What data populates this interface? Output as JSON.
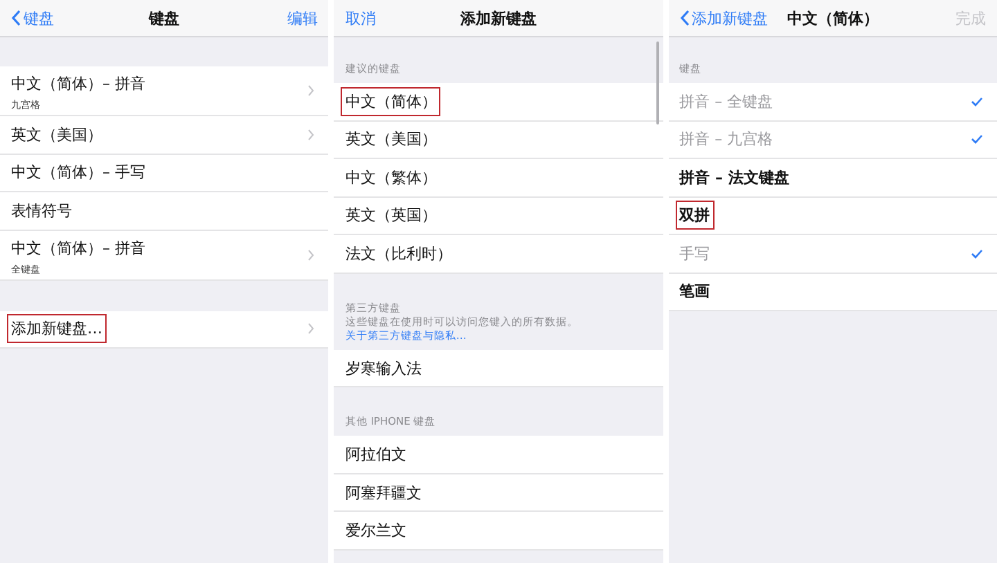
{
  "panels": [
    {
      "nav": {
        "left": {
          "label": "键盘",
          "arrow": true
        },
        "title": "键盘",
        "right": {
          "label": "编辑",
          "disabled": false
        }
      },
      "sections": [
        {
          "rows": [
            {
              "label": "中文（简体）– 拼音",
              "sublabel": "九宫格",
              "chevron": true,
              "highlighted": false
            },
            {
              "label": "英文（美国）",
              "chevron": true,
              "highlighted": false
            },
            {
              "label": "中文（简体）– 手写",
              "chevron": false,
              "highlighted": false
            },
            {
              "label": "表情符号",
              "chevron": false,
              "highlighted": false
            },
            {
              "label": "中文（简体）– 拼音",
              "sublabel": "全键盘",
              "chevron": true,
              "highlighted": false
            }
          ]
        },
        {
          "rows": [
            {
              "label": "添加新键盘…",
              "chevron": true,
              "highlighted": true
            }
          ]
        }
      ]
    },
    {
      "nav": {
        "left": {
          "label": "取消"
        },
        "title": "添加新键盘"
      },
      "scroll_indicator": true,
      "sections": [
        {
          "header": "建议的键盘",
          "rows": [
            {
              "label": "中文（简体）",
              "highlighted": true
            },
            {
              "label": "英文（美国）",
              "highlighted": false
            },
            {
              "label": "中文（繁体）",
              "highlighted": false
            },
            {
              "label": "英文（英国）",
              "highlighted": false
            },
            {
              "label": "法文（比利时）",
              "highlighted": false
            }
          ]
        },
        {
          "header": "第三方键盘",
          "note": "这些键盘在使用时可以访问您键入的所有数据。",
          "link": "关于第三方键盘与隐私…",
          "rows": [
            {
              "label": "岁寒输入法",
              "highlighted": false
            }
          ]
        },
        {
          "header": "其他 IPHONE 键盘",
          "rows": [
            {
              "label": "阿拉伯文",
              "highlighted": false
            },
            {
              "label": "阿塞拜疆文",
              "highlighted": false
            },
            {
              "label": "爱尔兰文",
              "highlighted": false
            }
          ]
        }
      ]
    },
    {
      "nav": {
        "left": {
          "label": "添加新键盘",
          "arrow": true
        },
        "title": "中文（简体）",
        "right": {
          "label": "完成",
          "disabled": true
        }
      },
      "sections": [
        {
          "header": "键盘",
          "rows": [
            {
              "label": "拼音 – 全键盘",
              "checked": true,
              "highlighted": false
            },
            {
              "label": "拼音 – 九宫格",
              "checked": true,
              "highlighted": false
            },
            {
              "label": "拼音 – 法文键盘",
              "checked": false,
              "highlighted": false
            },
            {
              "label": "双拼",
              "checked": false,
              "highlighted": true
            },
            {
              "label": "手写",
              "checked": true,
              "highlighted": false
            },
            {
              "label": "笔画",
              "checked": false,
              "highlighted": false
            }
          ]
        }
      ]
    }
  ]
}
